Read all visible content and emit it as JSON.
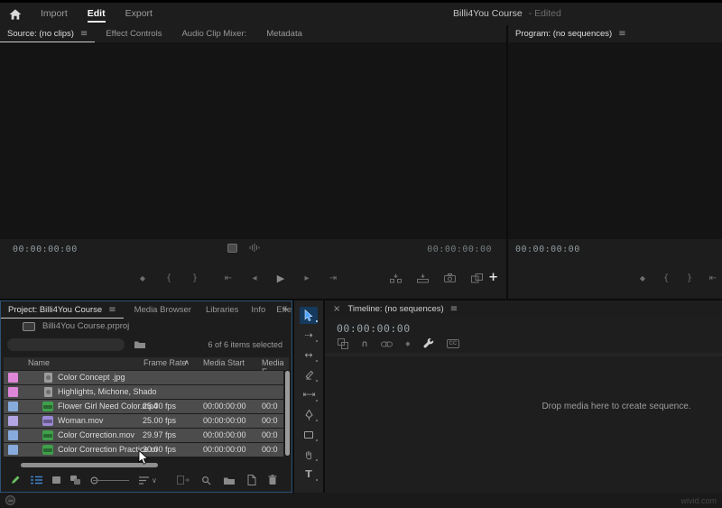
{
  "top_bar": {
    "tabs": [
      {
        "label": "Import"
      },
      {
        "label": "Edit"
      },
      {
        "label": "Export"
      }
    ],
    "title": "Billi4You Course",
    "status": "- Edited"
  },
  "source_panel": {
    "tabs": [
      {
        "label": "Source: (no clips)"
      },
      {
        "label": "Effect Controls"
      },
      {
        "label": "Audio Clip Mixer:"
      },
      {
        "label": "Metadata"
      }
    ],
    "timecode": "00:00:00:00",
    "duration": "00:00:00:00"
  },
  "program_panel": {
    "tab": "Program: (no sequences)",
    "timecode": "00:00:00:00"
  },
  "project_panel": {
    "tabs": [
      {
        "label": "Project: Billi4You Course"
      },
      {
        "label": "Media Browser"
      },
      {
        "label": "Libraries"
      },
      {
        "label": "Info"
      },
      {
        "label": "Effe"
      }
    ],
    "breadcrumb": "Billi4You Course.prproj",
    "search_value": "",
    "selection_status": "6 of 6 items selected",
    "columns": [
      "Name",
      "Frame Rate",
      "Media Start",
      "Media E"
    ],
    "rows": [
      {
        "label_color": "#df86d9",
        "icon_color": "#9c9c9c",
        "name": "Color Concept .jpg",
        "fps": "",
        "media_start": "",
        "media_end": ""
      },
      {
        "label_color": "#df86d9",
        "icon_color": "#9c9c9c",
        "name": "Highlights, Michone, Shado",
        "fps": "",
        "media_start": "",
        "media_end": ""
      },
      {
        "label_color": "#87abdc",
        "icon_color": "#3fa04b",
        "name": "Flower Girl Need Color.mp4",
        "fps": "25.00 fps",
        "media_start": "00:00:00:00",
        "media_end": "00:0"
      },
      {
        "label_color": "#b3a5e3",
        "icon_color": "#9c8ad6",
        "name": "Woman.mov",
        "fps": "25.00 fps",
        "media_start": "00:00:00:00",
        "media_end": "00:0"
      },
      {
        "label_color": "#87abdc",
        "icon_color": "#3fa04b",
        "name": "Color Correction.mov",
        "fps": "29.97 fps",
        "media_start": "00:00:00:00",
        "media_end": "00:0"
      },
      {
        "label_color": "#87abdc",
        "icon_color": "#3fa04b",
        "name": "Color Correction Practice.m",
        "fps": "30.00 fps",
        "media_start": "00:00:00:00",
        "media_end": "00:0"
      }
    ]
  },
  "timeline_panel": {
    "tab": "Timeline: (no sequences)",
    "timecode": "00:00:00:00",
    "drop_message": "Drop media here to create sequence."
  },
  "status_bar": {
    "watermark": "wivid.com"
  },
  "icons": {
    "menu": "≡",
    "overflow": "»",
    "sort_asc": "∧",
    "dropdown": "∨",
    "close": "×",
    "add_panel": "+",
    "cc": "CC",
    "marker": "◆",
    "in_point": "{",
    "out_point": "}",
    "goto_in": "⇤",
    "step_back": "◂",
    "play": "▶",
    "step_forward": "▸",
    "goto_out": "⇥",
    "magnet": "∩",
    "track_select": "⇢",
    "ripple_edit": "↔",
    "slip": "⇤⇥",
    "type_tool": "T"
  },
  "colors": {
    "accent_blue": "#2f7fd6",
    "focus_border": "#3e7dc4",
    "pen_green": "#6abf5e",
    "list_view_blue": "#3f87d4"
  }
}
